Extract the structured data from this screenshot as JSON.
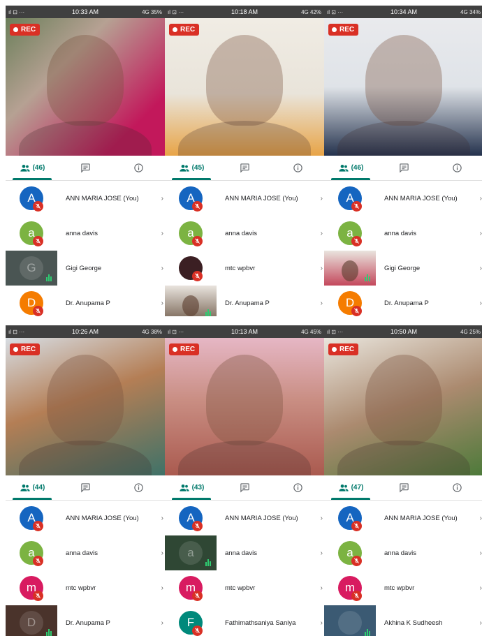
{
  "colors": {
    "accent": "#00796b",
    "rec": "#d93025",
    "avatar_blue": "#1565c0",
    "avatar_green": "#7cb342",
    "avatar_orange": "#f57c00",
    "avatar_pink": "#d81b60",
    "avatar_teal": "#00897b"
  },
  "panels": [
    {
      "time": "10:33 AM",
      "status_left": "ıl ⊡ ···",
      "status_right": "4G 35%",
      "rec": "REC",
      "count": "(46)",
      "rows": [
        {
          "name": "ANN MARIA JOSE (You)",
          "letter": "A"
        },
        {
          "name": "anna davis",
          "letter": "a"
        },
        {
          "name": "Gigi George",
          "letter": "G"
        },
        {
          "name": "Dr. Anupama P",
          "letter": "D"
        }
      ]
    },
    {
      "time": "10:18 AM",
      "status_left": "ıl ⊡ ···",
      "status_right": "4G 42%",
      "rec": "REC",
      "count": "(45)",
      "rows": [
        {
          "name": "ANN MARIA JOSE (You)",
          "letter": "A"
        },
        {
          "name": "anna davis",
          "letter": "a"
        },
        {
          "name": "mtc wpbvr",
          "letter": ""
        },
        {
          "name": "Dr. Anupama P",
          "letter": ""
        }
      ]
    },
    {
      "time": "10:34 AM",
      "status_left": "ıl ⊡ ···",
      "status_right": "4G 34%",
      "rec": "REC",
      "count": "(46)",
      "rows": [
        {
          "name": "ANN MARIA JOSE (You)",
          "letter": "A"
        },
        {
          "name": "anna davis",
          "letter": "a"
        },
        {
          "name": "Gigi George",
          "letter": ""
        },
        {
          "name": "Dr. Anupama P",
          "letter": "D"
        }
      ]
    },
    {
      "time": "10:26 AM",
      "status_left": "ıl ⊡ ···",
      "status_right": "4G 38%",
      "rec": "REC",
      "count": "(44)",
      "rows": [
        {
          "name": "ANN MARIA JOSE (You)",
          "letter": "A"
        },
        {
          "name": "anna davis",
          "letter": "a"
        },
        {
          "name": "mtc wpbvr",
          "letter": "m"
        },
        {
          "name": "Dr. Anupama P",
          "letter": "D"
        }
      ]
    },
    {
      "time": "10:13 AM",
      "status_left": "ıl ⊡ ···",
      "status_right": "4G 45%",
      "rec": "REC",
      "count": "(43)",
      "rows": [
        {
          "name": "ANN MARIA JOSE (You)",
          "letter": "A"
        },
        {
          "name": "anna davis",
          "letter": "a"
        },
        {
          "name": "mtc wpbvr",
          "letter": "m"
        },
        {
          "name": "Fathimathsaniya Saniya",
          "letter": "F"
        }
      ]
    },
    {
      "time": "10:50 AM",
      "status_left": "ıl ⊡ ···",
      "status_right": "4G 25%",
      "rec": "REC",
      "count": "(47)",
      "rows": [
        {
          "name": "ANN MARIA JOSE (You)",
          "letter": "A"
        },
        {
          "name": "anna davis",
          "letter": "a"
        },
        {
          "name": "mtc wpbvr",
          "letter": "m"
        },
        {
          "name": "Akhina K Sudheesh",
          "letter": ""
        }
      ]
    }
  ]
}
